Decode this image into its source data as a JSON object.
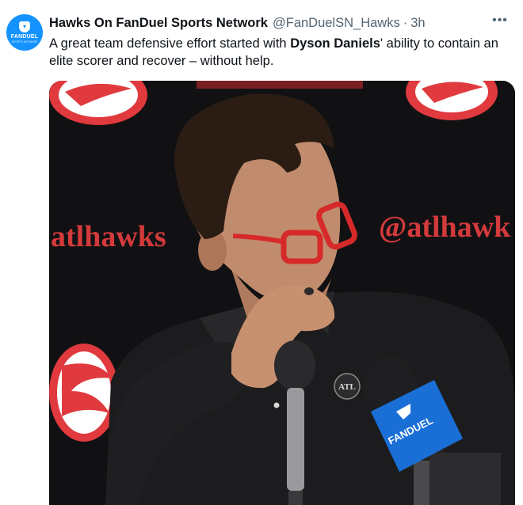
{
  "tweet": {
    "avatar_brand": "FANDUEL",
    "avatar_sub": "SPORTS NETWORK",
    "display_name": "Hawks On FanDuel Sports Network",
    "handle": "@FanDuelSN_Hawks",
    "separator": "·",
    "time": "3h",
    "text_before": "A great team defensive effort started with ",
    "text_bold": "Dyson Daniels",
    "text_after": "' ability to contain an elite scorer and recover – without help."
  },
  "media": {
    "backdrop_text_left": "atlhawks",
    "backdrop_text_right": "@atlhawk",
    "shirt_patch": "ATL",
    "mic_flag_brand": "FANDUEL",
    "backdrop_color": "#111113",
    "logo_red": "#e03a3e",
    "glasses_red": "#d62a2a"
  }
}
